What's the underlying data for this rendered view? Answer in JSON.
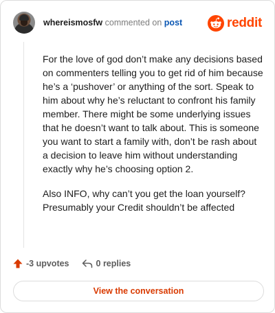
{
  "comment": {
    "username": "whereismosfw",
    "action_text": "commented on",
    "target_link": "post",
    "paragraphs": [
      "For the love of god don’t make any decisions based on commenters telling you to get rid of him because he’s a ‘pushover’ or anything of the sort. Speak to him about why he’s reluctant to confront his family member. There might be some underlying issues that he doesn’t want to talk about. This is someone you want to start a family with, don’t be rash about a decision to leave him without understanding exactly why he’s choosing option 2.",
      "Also INFO, why can’t you get the loan yourself? Presumably your Credit shouldn’t be affected"
    ]
  },
  "brand": {
    "wordmark": "reddit",
    "color": "#ff4500"
  },
  "stats": {
    "upvotes_label": "-3 upvotes",
    "replies_label": "0 replies"
  },
  "cta": {
    "view_conversation": "View the conversation",
    "color": "#d93a00"
  },
  "icons": {
    "avatar": "user-avatar",
    "logo": "reddit-snoo-icon",
    "upvote": "upvote-arrow-icon",
    "reply": "reply-arrow-icon"
  }
}
